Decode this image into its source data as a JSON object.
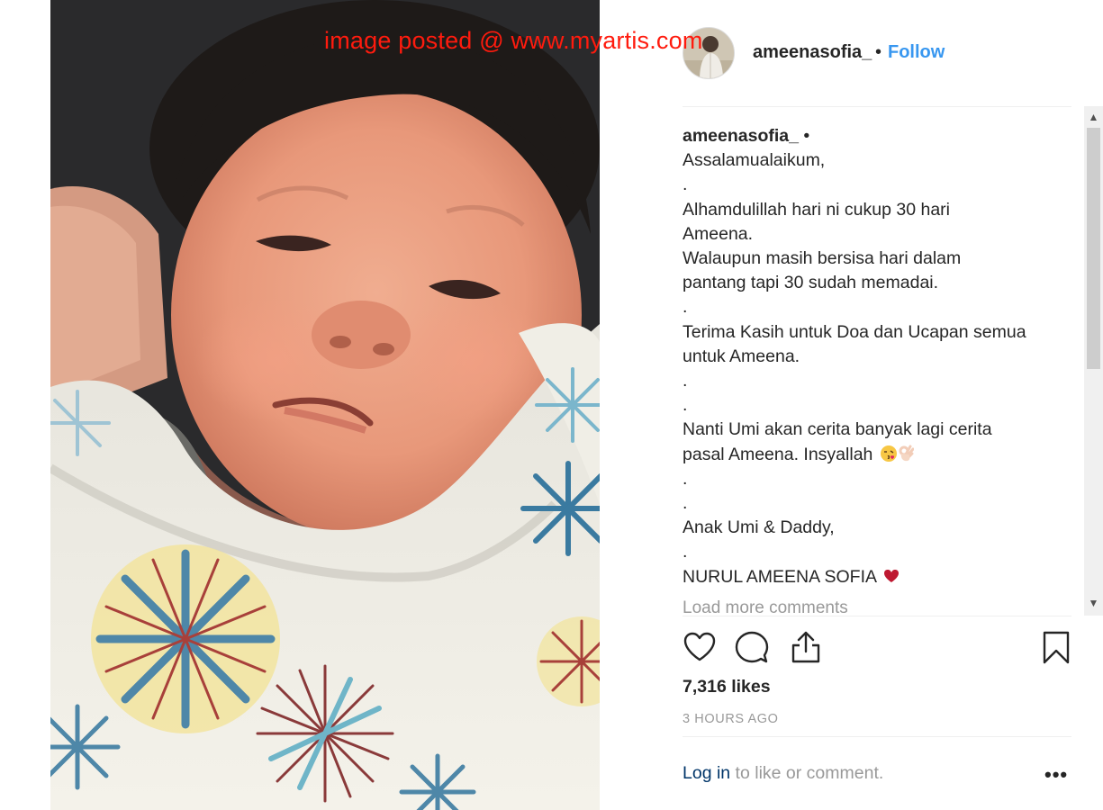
{
  "watermark": "image posted @ www.myartis.com",
  "post": {
    "username": "ameenasofia_",
    "header_dot": "•",
    "follow_label": "Follow"
  },
  "caption": {
    "username": "ameenasofia_",
    "user_dot": "•",
    "lines": [
      "Assalamualaikum,",
      ".",
      "Alhamdulillah hari ni cukup 30 hari",
      "Ameena.",
      "Walaupun masih bersisa hari dalam",
      "pantang tapi 30 sudah memadai.",
      ".",
      "Terima Kasih untuk Doa dan Ucapan semua",
      "untuk Ameena.",
      ".",
      ".",
      "Nanti Umi akan cerita banyak lagi cerita",
      "pasal Ameena. Insyallah",
      ".",
      ".",
      "Anak Umi & Daddy,",
      ".",
      "NURUL AMEENA SOFIA"
    ],
    "emojis": {
      "line_12": [
        "kissing-face-emoji",
        "ok-hand-emoji"
      ],
      "line_18": [
        "red-heart-emoji"
      ]
    },
    "load_more": "Load more comments"
  },
  "actions": {
    "icons": [
      "heart-icon",
      "comment-icon",
      "share-icon",
      "bookmark-icon"
    ]
  },
  "likes": "7,316 likes",
  "timestamp": "3 HOURS AGO",
  "login_prompt": {
    "link": "Log in",
    "rest": " to like or comment."
  },
  "more_options": "•••",
  "scrollbar": {
    "up_arrow": "▲",
    "down_arrow": "▼"
  },
  "colors": {
    "follow_blue": "#3897f0",
    "watermark_red": "#ff1b0e",
    "link_dark_blue": "#003569",
    "muted_gray": "#999999",
    "text": "#262626"
  }
}
